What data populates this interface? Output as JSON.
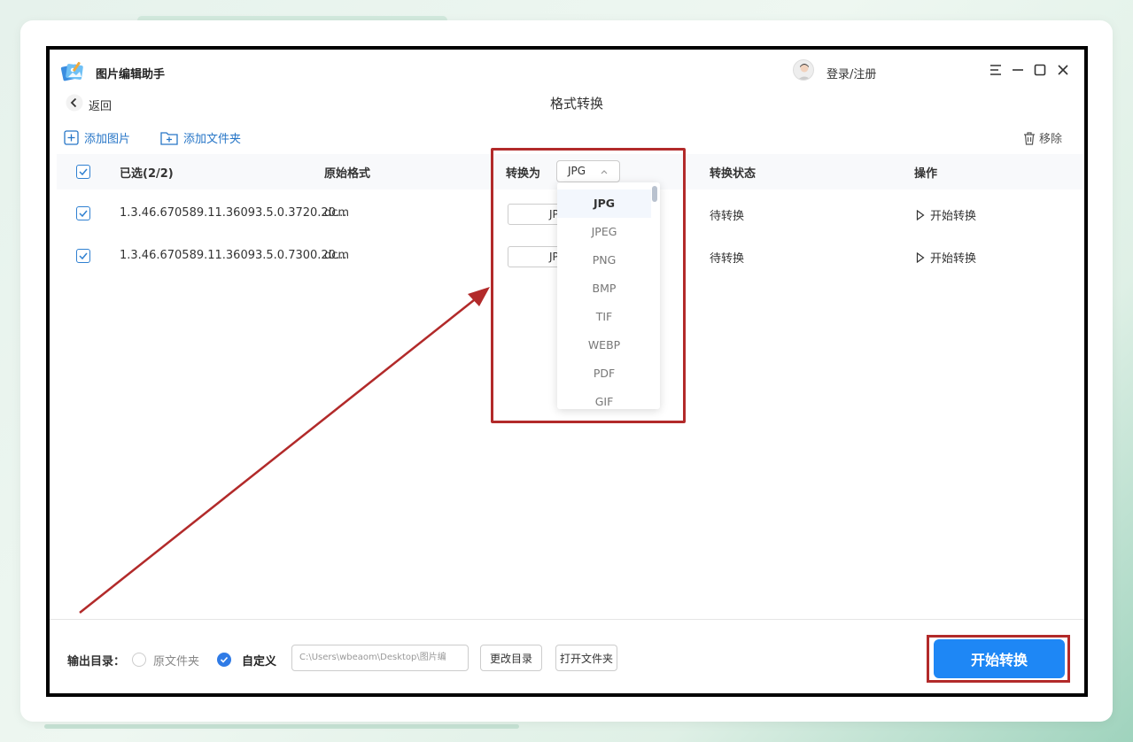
{
  "app": {
    "title": "图片编辑助手",
    "login": "登录/注册"
  },
  "nav": {
    "back": "返回",
    "page_title": "格式转换"
  },
  "toolbar": {
    "add_image": "添加图片",
    "add_folder": "添加文件夹",
    "remove": "移除"
  },
  "table": {
    "headers": {
      "selected": "已选(2/2)",
      "original_format": "原始格式",
      "convert_to": "转换为",
      "status": "转换状态",
      "operation": "操作"
    },
    "convert_to_value": "JPG",
    "rows": [
      {
        "name": "1.3.46.670589.11.36093.5.0.3720.20...",
        "format": "dcm",
        "target": "JPG",
        "status": "待转换",
        "action": "开始转换"
      },
      {
        "name": "1.3.46.670589.11.36093.5.0.7300.20...",
        "format": "dcm",
        "target": "JPG",
        "status": "待转换",
        "action": "开始转换"
      }
    ]
  },
  "dropdown": {
    "selected": "JPG",
    "options": [
      "JPG",
      "JPEG",
      "PNG",
      "BMP",
      "TIF",
      "WEBP",
      "PDF",
      "GIF"
    ]
  },
  "output": {
    "label": "输出目录：",
    "option_original": "原文件夹",
    "option_custom": "自定义",
    "path": "C:\\Users\\wbeaom\\Desktop\\图片编",
    "change_dir": "更改目录",
    "open_folder": "打开文件夹",
    "start": "开始转换"
  },
  "colors": {
    "accent": "#1e87f5",
    "annotation": "#b22a2a"
  }
}
